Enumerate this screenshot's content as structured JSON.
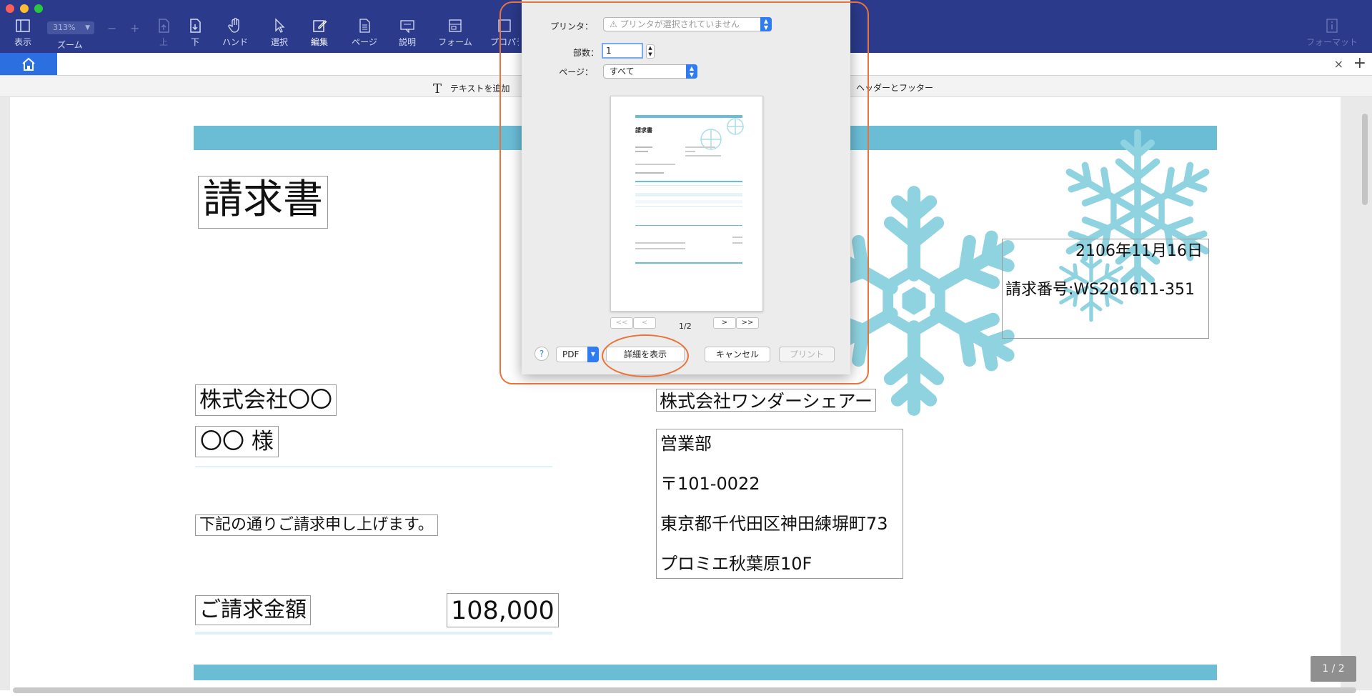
{
  "toolbar": {
    "view": "表示",
    "zoom_value": "313%",
    "zoom": "ズーム",
    "up": "上",
    "down": "下",
    "hand": "ハンド",
    "select": "選択",
    "edit": "編集",
    "page": "ページ",
    "comment": "説明",
    "form": "フォーム",
    "property": "プロパティ",
    "format": "フォーマット"
  },
  "tabbar": {
    "close": "×",
    "add": "+"
  },
  "subbar": {
    "add_text": "テキストを追加",
    "header_footer": "ヘッダーとフッター"
  },
  "document": {
    "title": "請求書",
    "date": "2106年11月16日",
    "invoice_no": "請求番号:WS201611-351",
    "client_company": "株式会社〇〇",
    "client_person": "〇〇 様",
    "message": "下記の通りご請求申し上げます。",
    "amount_label": "ご請求金額",
    "amount_value": "108,000",
    "issuer_company": "株式会社ワンダーシェアー",
    "issuer_dept": "営業部",
    "issuer_postal": "〒101-0022",
    "issuer_address1": "東京都千代田区神田練塀町73",
    "issuer_address2": "プロミエ秋葉原10F"
  },
  "page_indicator": "1 / 2",
  "print_dialog": {
    "printer_label": "プリンタ：",
    "printer_value": "⚠ プリンタが選択されていません",
    "copies_label": "部数：",
    "copies_value": "1",
    "pages_label": "ページ：",
    "pages_value": "すべて",
    "page_count": "1/2",
    "nav_first": "<<",
    "nav_prev": "<",
    "nav_next": ">",
    "nav_last": ">>",
    "help": "?",
    "pdf": "PDF",
    "show_details": "詳細を表示",
    "cancel": "キャンセル",
    "print": "プリント",
    "preview_title": "請求書"
  },
  "colors": {
    "toolbar_bg": "#2b3a8a",
    "home_tab": "#2b6fe0",
    "band": "#6bbdd6",
    "snowflake": "#8fd3e1",
    "annotation": "#e8743b",
    "accent": "#2f7bf2"
  }
}
